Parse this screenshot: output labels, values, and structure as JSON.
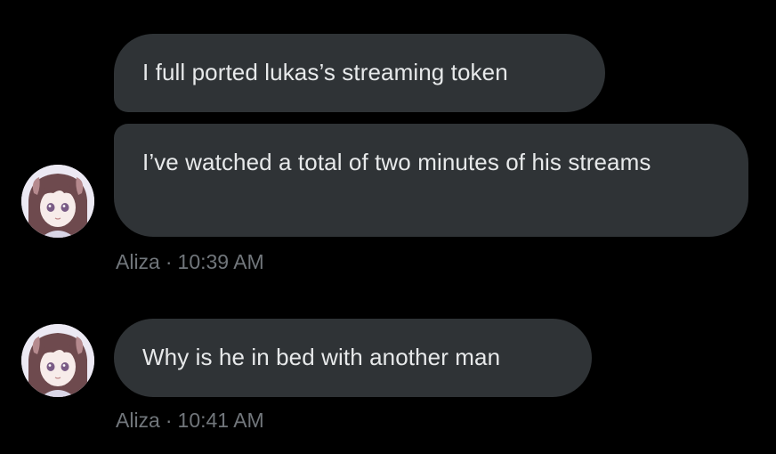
{
  "conversation": {
    "messages": [
      {
        "text": "I full ported lukas’s streaming token"
      },
      {
        "text": "I’ve watched a total of two minutes of his streams"
      },
      {
        "text": "Why is he in bed with another man"
      }
    ],
    "groups": [
      {
        "sender": "Aliza",
        "separator": "·",
        "time": "10:39 AM",
        "avatar": "anime-girl-avatar"
      },
      {
        "sender": "Aliza",
        "separator": "·",
        "time": "10:41 AM",
        "avatar": "anime-girl-avatar"
      }
    ]
  },
  "colors": {
    "background": "#000000",
    "bubble": "#2f3336",
    "text": "#e7e9ea",
    "meta": "#71767b"
  }
}
